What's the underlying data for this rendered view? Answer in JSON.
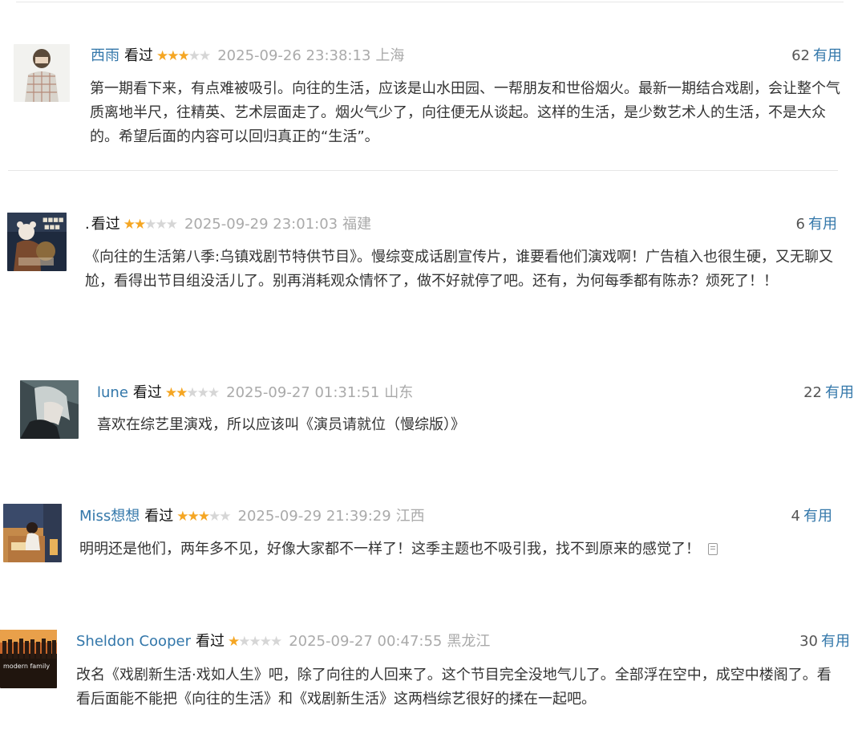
{
  "comments": [
    {
      "user": "西雨",
      "seen": "看过",
      "stars": 3,
      "time": "2025-09-26 23:38:13",
      "location": "上海",
      "votes": "62",
      "useful_label": "有用",
      "text": "第一期看下来，有点难被吸引。向往的生活，应该是山水田园、一帮朋友和世俗烟火。最新一期结合戏剧，会让整个气质离地半尺，往精英、艺术层面走了。烟火气少了，向往便无从谈起。这样的生活，是少数艺术人的生活，不是大众的。希望后面的内容可以回归真正的“生活”。"
    },
    {
      "user": ".",
      "seen": "看过",
      "stars": 2,
      "time": "2025-09-29 23:01:03",
      "location": "福建",
      "votes": "6",
      "useful_label": "有用",
      "text": "《向往的生活第八季:乌镇戏剧节特供节目》。慢综变成话剧宣传片，谁要看他们演戏啊！广告植入也很生硬，又无聊又尬，看得出节目组没活儿了。别再消耗观众情怀了，做不好就停了吧。还有，为何每季都有陈赤？烦死了！！"
    },
    {
      "user": "lune",
      "seen": "看过",
      "stars": 2,
      "time": "2025-09-27 01:31:51",
      "location": "山东",
      "votes": "22",
      "useful_label": "有用",
      "text": "喜欢在综艺里演戏，所以应该叫《演员请就位（慢综版）》"
    },
    {
      "user": "Miss想想",
      "seen": "看过",
      "stars": 3,
      "time": "2025-09-29 21:39:29",
      "location": "江西",
      "votes": "4",
      "useful_label": "有用",
      "text": "明明还是他们，两年多不见，好像大家都不一样了！这季主题也不吸引我，找不到原来的感觉了！"
    },
    {
      "user": "Sheldon Cooper",
      "seen": "看过",
      "stars": 1,
      "time": "2025-09-27 00:47:55",
      "location": "黑龙江",
      "votes": "30",
      "useful_label": "有用",
      "text": "改名《戏剧新生活·戏如人生》吧，除了向往的人回来了。这个节目完全没地气儿了。全部浮在空中，成空中楼阁了。看看后面能不能把《向往的生活》和《戏剧新生活》这两档综艺很好的揉在一起吧。"
    }
  ],
  "avatars": {
    "c5_text": "modern family"
  }
}
